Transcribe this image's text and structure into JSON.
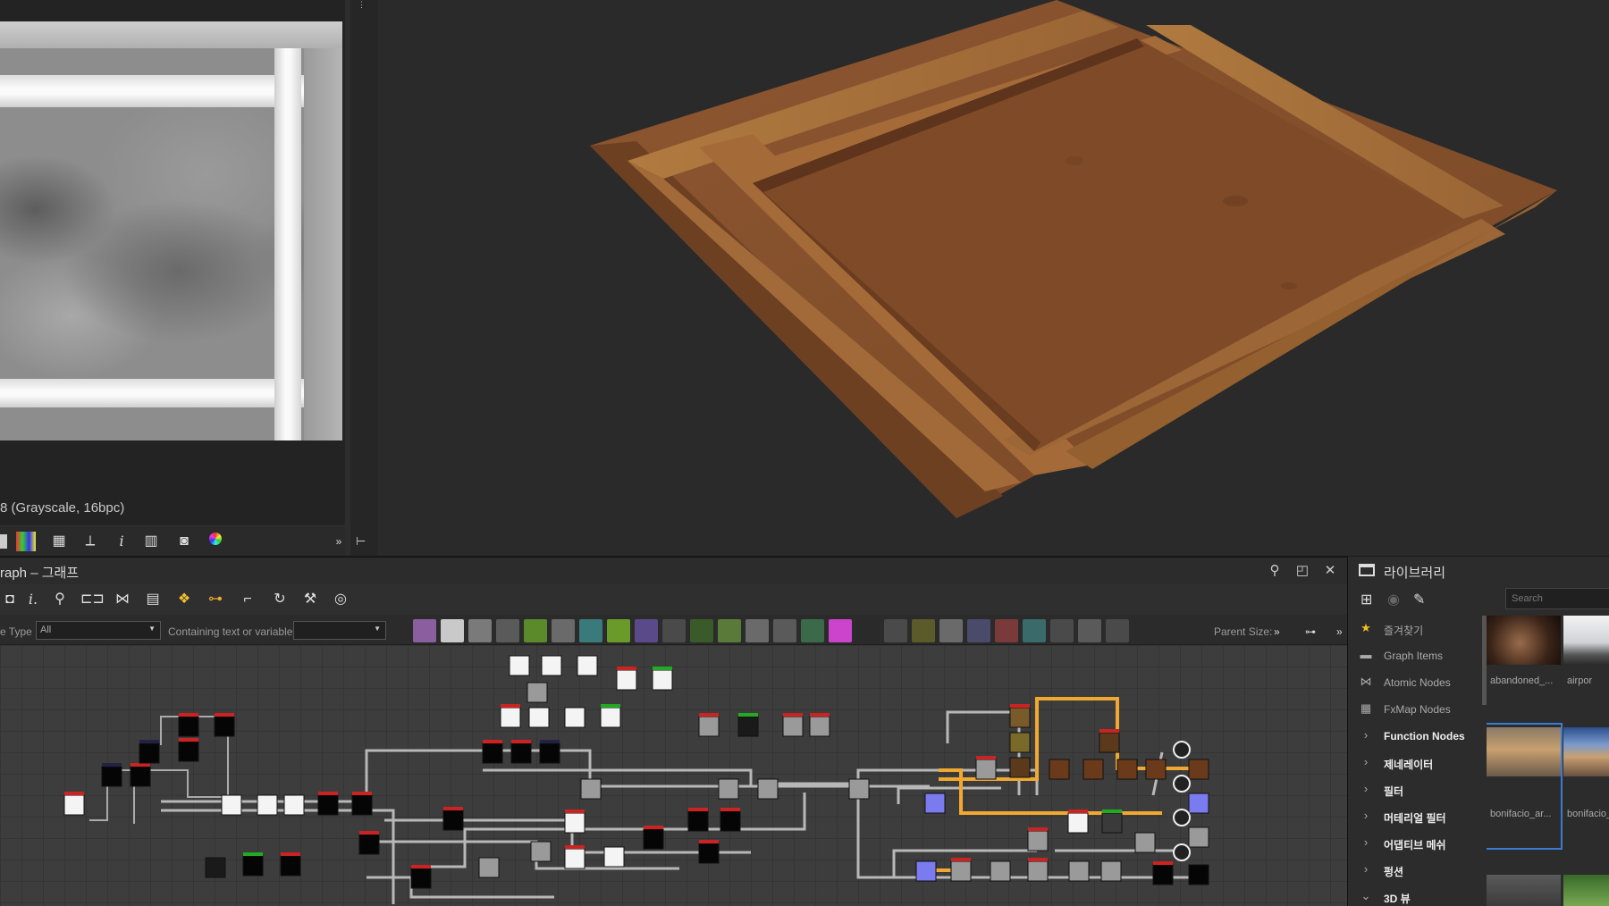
{
  "view2d": {
    "status": "8 (Grayscale, 16bpc)",
    "toolbar_icons": [
      "color-ramp-icon",
      "grid-icon",
      "tiling-icon",
      "info-icon",
      "histogram-icon",
      "display-icon",
      "color-wheel-icon"
    ],
    "overflow": "»"
  },
  "graph": {
    "title": "raph – 그래프",
    "filter_type_label": "e Type",
    "filter_type_value": "All",
    "containing_label": "Containing text or variable",
    "containing_value": "",
    "parent_size_label": "Parent Size:",
    "overflow": "»"
  },
  "library": {
    "title": "라이브러리",
    "search_placeholder": "Search",
    "items": [
      {
        "icon": "star-icon",
        "label": "즐겨찾기"
      },
      {
        "icon": "comment-icon",
        "label": "Graph Items"
      },
      {
        "icon": "share-icon",
        "label": "Atomic Nodes"
      },
      {
        "icon": "grid-icon",
        "label": "FxMap Nodes"
      },
      {
        "icon": "chevron-right-icon",
        "label": "Function Nodes"
      },
      {
        "icon": "chevron-right-icon",
        "label": "제네레이터"
      },
      {
        "icon": "chevron-right-icon",
        "label": "필터"
      },
      {
        "icon": "chevron-right-icon",
        "label": "머테리얼 필터"
      },
      {
        "icon": "chevron-right-icon",
        "label": "어댑티브 메쉬"
      },
      {
        "icon": "chevron-right-icon",
        "label": "펑션"
      },
      {
        "icon": "chevron-down-icon",
        "label": "3D 뷰"
      }
    ],
    "thumbnails": [
      {
        "caption": "abandoned_..."
      },
      {
        "caption": "airpor"
      },
      {
        "caption": "bonifacio_ar..."
      },
      {
        "caption": "bonifacio_"
      }
    ]
  },
  "colors": {
    "accent_orange": "#f0a830",
    "material_brown": "#8a5230",
    "node_blue": "#7b7bf0",
    "panel_bg": "#2c2c2c"
  }
}
